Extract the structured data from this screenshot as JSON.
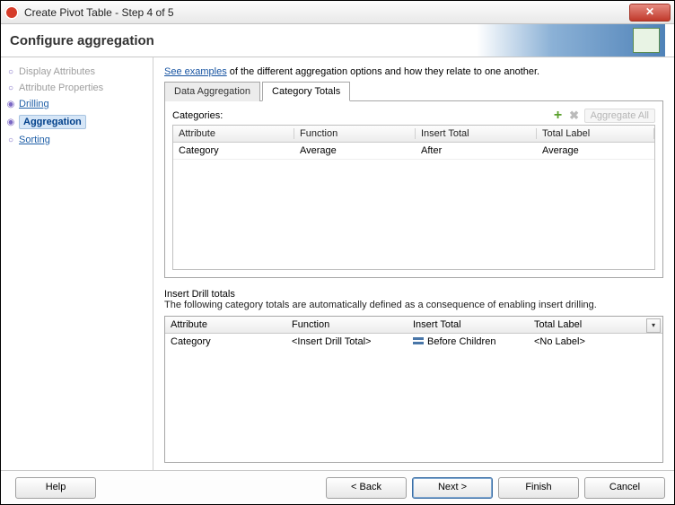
{
  "window": {
    "title": "Create Pivot Table - Step 4 of 5"
  },
  "header": {
    "title": "Configure aggregation"
  },
  "sidebar": {
    "items": [
      {
        "label": "Display Attributes"
      },
      {
        "label": "Attribute Properties"
      },
      {
        "label": "Drilling"
      },
      {
        "label": "Aggregation"
      },
      {
        "label": "Sorting"
      }
    ]
  },
  "intro_link": "See examples",
  "intro_rest": " of the different aggregation options and how they relate to one another.",
  "tabs": {
    "data_aggregation": "Data Aggregation",
    "category_totals": "Category Totals"
  },
  "categories_panel": {
    "label": "Categories:",
    "aggregate_all": "Aggregate All",
    "headers": {
      "attribute": "Attribute",
      "function": "Function",
      "insert_total": "Insert Total",
      "total_label": "Total Label"
    },
    "rows": [
      {
        "attribute": "Category",
        "function": "Average",
        "insert_total": "After",
        "total_label": "Average"
      }
    ]
  },
  "insert_drill": {
    "title": "Insert Drill totals",
    "subtitle": "The following category totals are automatically defined as a consequence of enabling insert drilling.",
    "headers": {
      "attribute": "Attribute",
      "function": "Function",
      "insert_total": "Insert Total",
      "total_label": "Total Label"
    },
    "rows": [
      {
        "attribute": "Category",
        "function": "<Insert Drill Total>",
        "insert_total": "Before Children",
        "total_label": "<No Label>"
      }
    ]
  },
  "buttons": {
    "help": "Help",
    "back": "< Back",
    "next": "Next >",
    "finish": "Finish",
    "cancel": "Cancel"
  }
}
